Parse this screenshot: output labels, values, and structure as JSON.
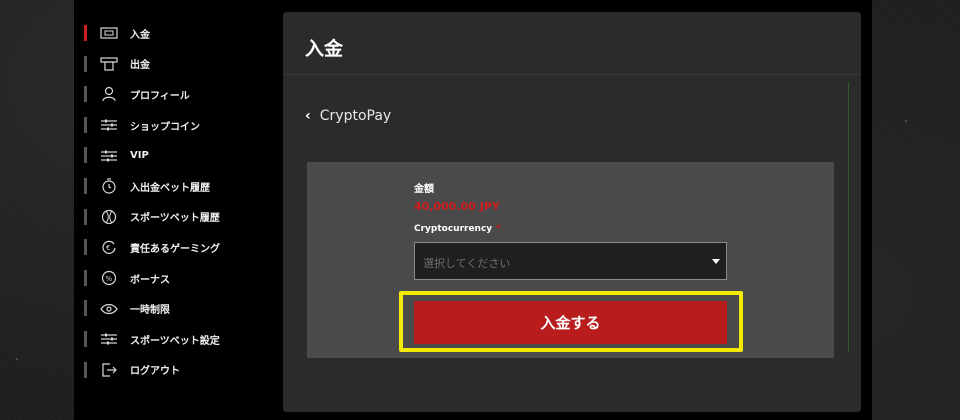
{
  "sidebar": {
    "items": [
      {
        "label": "入金",
        "icon": "wallet-icon",
        "active": true
      },
      {
        "label": "出金",
        "icon": "withdraw-icon",
        "active": false
      },
      {
        "label": "プロフィール",
        "icon": "user-icon",
        "active": false
      },
      {
        "label": "ショップコイン",
        "icon": "sliders-icon",
        "active": false
      },
      {
        "label": "VIP",
        "icon": "sliders-icon",
        "active": false
      },
      {
        "label": "入出金ベット履歴",
        "icon": "history-icon",
        "active": false
      },
      {
        "label": "スポーツベット履歴",
        "icon": "ball-icon",
        "active": false
      },
      {
        "label": "責任あるゲーミング",
        "icon": "euro-refresh-icon",
        "active": false
      },
      {
        "label": "ボーナス",
        "icon": "percent-icon",
        "active": false
      },
      {
        "label": "一時制限",
        "icon": "eye-icon",
        "active": false
      },
      {
        "label": "スポーツベット設定",
        "icon": "sliders-icon",
        "active": false
      },
      {
        "label": "ログアウト",
        "icon": "logout-icon",
        "active": false
      }
    ]
  },
  "main": {
    "title": "入金",
    "back_label": "CryptoPay",
    "form": {
      "amount_label": "金額",
      "amount_value": "40,000.00 JPY",
      "crypto_label": "Cryptocurrency",
      "required_mark": "*",
      "select_placeholder": "選択してください",
      "submit_label": "入金する"
    }
  },
  "colors": {
    "accent_red": "#cc1f1f",
    "button_red": "#b91c1c",
    "highlight_yellow": "#f2ea00"
  }
}
